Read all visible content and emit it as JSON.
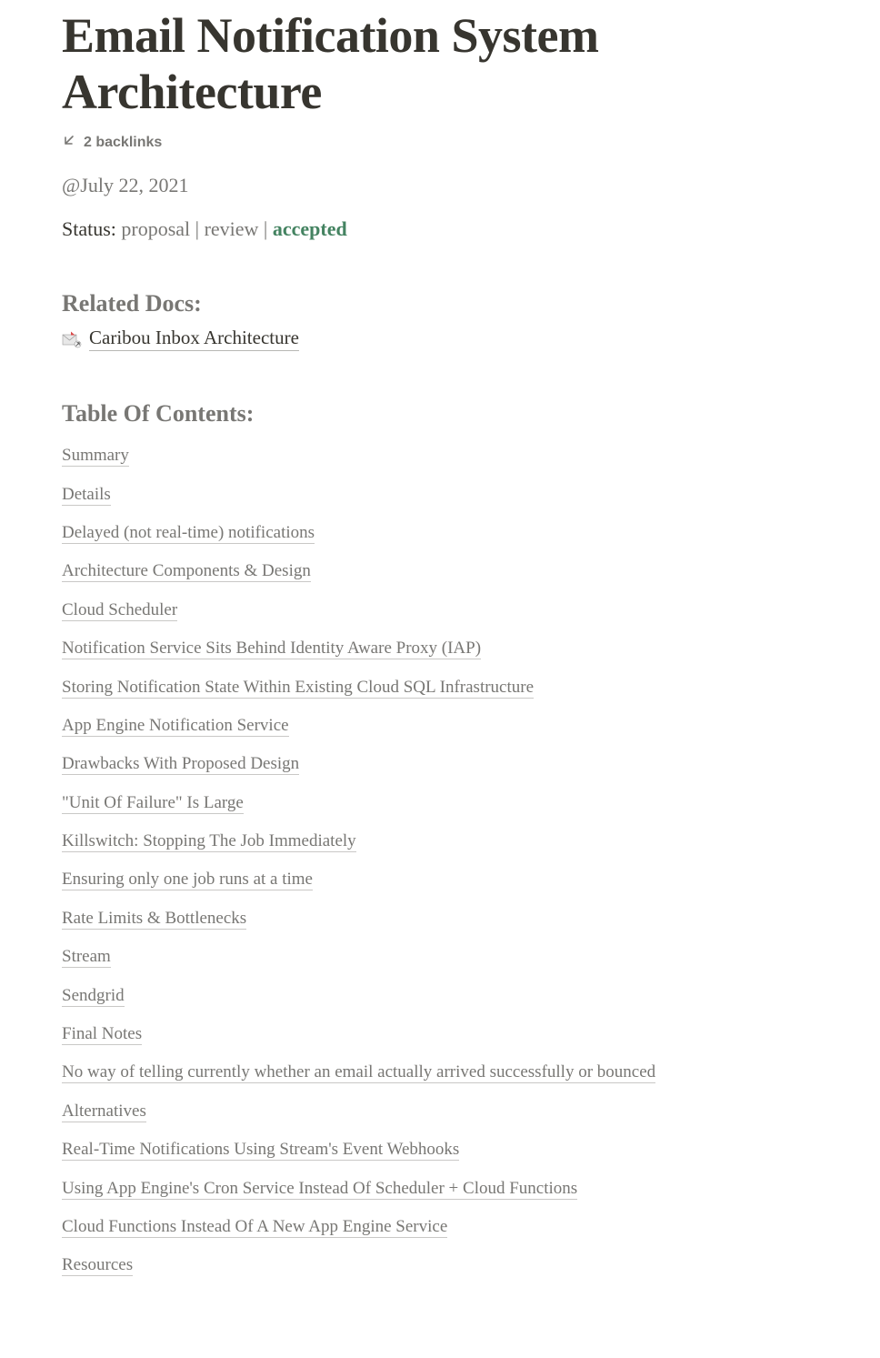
{
  "title": "Email Notification System Architecture",
  "backlinks": {
    "label": "2 backlinks"
  },
  "date_prefix": "@",
  "date": "July 22, 2021",
  "status": {
    "label": "Status: ",
    "options": "proposal | review | ",
    "accepted": "accepted"
  },
  "sections": {
    "related_docs_heading": "Related Docs:",
    "toc_heading": "Table Of Contents:"
  },
  "related_docs": [
    {
      "label": "Caribou Inbox Architecture"
    }
  ],
  "toc": [
    {
      "level": 0,
      "label": "Summary"
    },
    {
      "level": 0,
      "label": "Details"
    },
    {
      "level": 1,
      "label": "Delayed (not real-time) notifications"
    },
    {
      "level": 1,
      "label": "Architecture Components & Design"
    },
    {
      "level": 2,
      "label": "Cloud Scheduler"
    },
    {
      "level": 2,
      "label": "Notification Service Sits Behind Identity Aware Proxy (IAP)"
    },
    {
      "level": 2,
      "label": "Storing Notification State Within Existing Cloud SQL Infrastructure"
    },
    {
      "level": 2,
      "label": "App Engine Notification Service"
    },
    {
      "level": 1,
      "label": "Drawbacks With Proposed Design"
    },
    {
      "level": 2,
      "label": "\"Unit Of Failure\" Is Large"
    },
    {
      "level": 1,
      "label": "Killswitch: Stopping The Job Immediately"
    },
    {
      "level": 1,
      "label": "Ensuring only one job runs at a time"
    },
    {
      "level": 1,
      "label": "Rate Limits & Bottlenecks"
    },
    {
      "level": 2,
      "label": "Stream"
    },
    {
      "level": 2,
      "label": "Sendgrid"
    },
    {
      "level": 1,
      "label": "Final Notes"
    },
    {
      "level": 2,
      "label": "No way of telling currently whether an email actually arrived successfully or bounced"
    },
    {
      "level": 0,
      "label": "Alternatives"
    },
    {
      "level": 1,
      "label": "Real-Time Notifications Using Stream's Event Webhooks"
    },
    {
      "level": 1,
      "label": "Using App Engine's Cron Service Instead Of Scheduler + Cloud Functions"
    },
    {
      "level": 1,
      "label": "Cloud Functions Instead Of A New App Engine Service"
    },
    {
      "level": 0,
      "label": "Resources"
    }
  ]
}
